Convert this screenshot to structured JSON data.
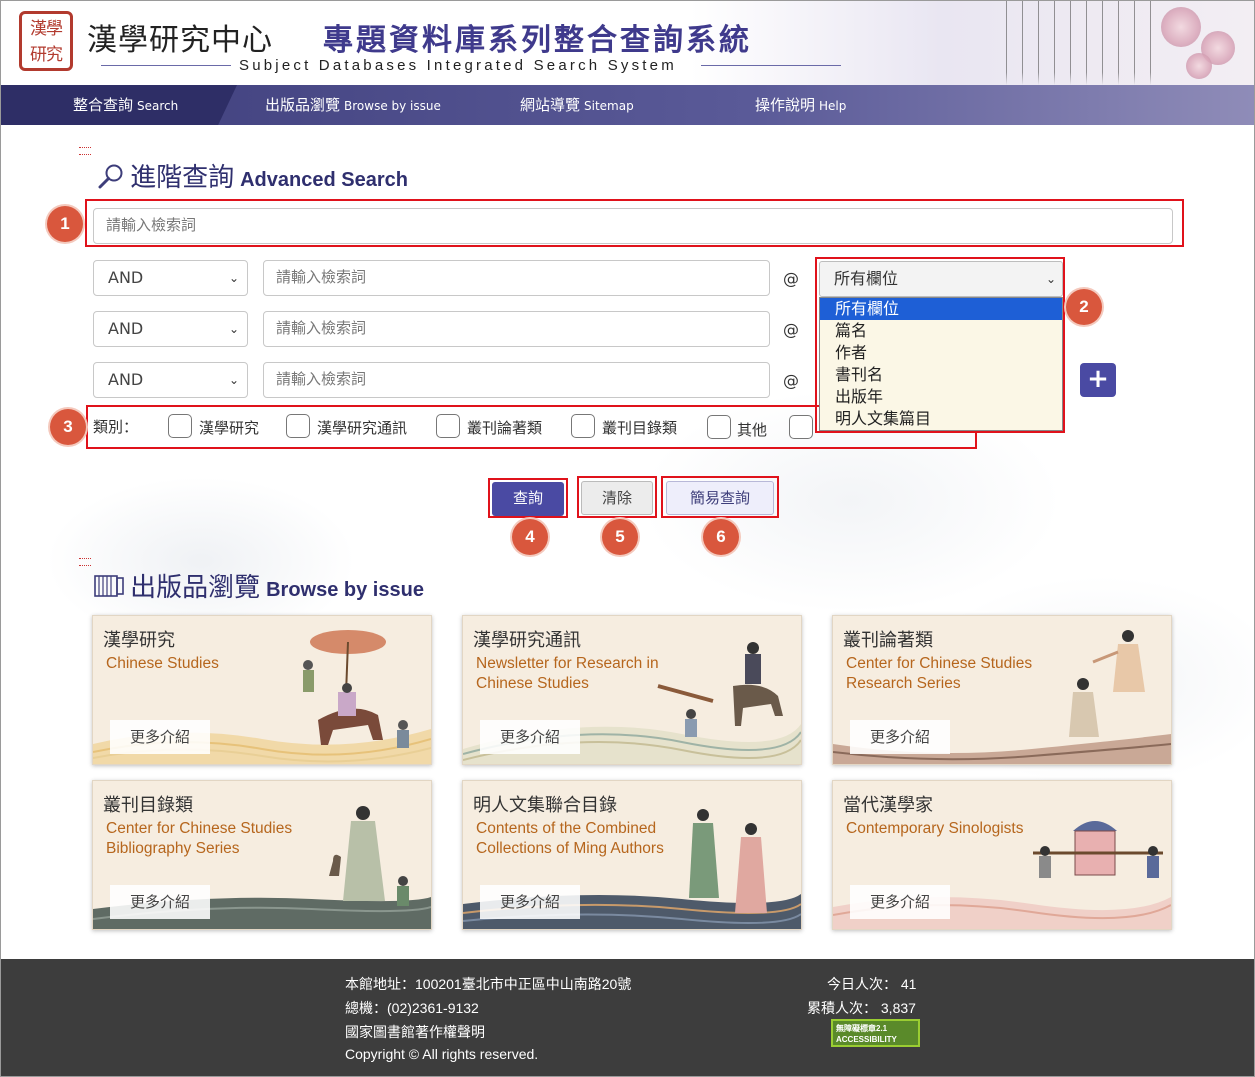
{
  "header": {
    "seal_text": "漢學研究",
    "title_cn": "漢學研究中心",
    "title_system": "專題資料庫系列整合查詢系統",
    "title_en": "Subject Databases Integrated Search System"
  },
  "nav": {
    "items": [
      {
        "cn": "整合查詢",
        "en": "Search"
      },
      {
        "cn": "出版品瀏覽",
        "en": "Browse by issue"
      },
      {
        "cn": "網站導覽",
        "en": "Sitemap"
      },
      {
        "cn": "操作說明",
        "en": "Help"
      }
    ]
  },
  "advanced": {
    "title_cn": "進階查詢",
    "title_en": "Advanced Search",
    "placeholder": "請輸入檢索詞",
    "operator": "AND",
    "at": "@",
    "field_selected": "所有欄位",
    "field_options": [
      "所有欄位",
      "篇名",
      "作者",
      "書刊名",
      "出版年",
      "明人文集篇目"
    ],
    "category_label": "類別：",
    "categories": [
      "漢學研究",
      "漢學研究通訊",
      "叢刊論著類",
      "叢刊目錄類",
      "其他"
    ]
  },
  "buttons": {
    "search": "查詢",
    "clear": "清除",
    "simple": "簡易查詢"
  },
  "badges": [
    "1",
    "2",
    "3",
    "4",
    "5",
    "6"
  ],
  "browse": {
    "title_cn": "出版品瀏覽",
    "title_en": "Browse by issue",
    "more": "更多介紹",
    "cards": [
      {
        "title": "漢學研究",
        "subtitle": "Chinese Studies"
      },
      {
        "title": "漢學研究通訊",
        "subtitle": "Newsletter for Research in Chinese Studies"
      },
      {
        "title": "叢刊論著類",
        "subtitle": "Center for Chinese Studies Research Series"
      },
      {
        "title": "叢刊目錄類",
        "subtitle": "Center for Chinese Studies Bibliography Series"
      },
      {
        "title": "明人文集聯合目錄",
        "subtitle": "Contents of the Combined Collections of Ming Authors"
      },
      {
        "title": "當代漢學家",
        "subtitle": "Contemporary Sinologists"
      }
    ]
  },
  "footer": {
    "address": "本館地址：100201臺北市中正區中山南路20號",
    "phone": "總機：(02)2361-9132",
    "copyright_notice": "國家圖書館著作權聲明",
    "copyright": "Copyright © All rights reserved.",
    "today_label": "今日人次：",
    "today_value": "41",
    "total_label": "累積人次：",
    "total_value": "3,837",
    "accessibility": "無障礙標章2.1 ACCESSIBILITY"
  },
  "colors": {
    "nav": "#3d3d7a",
    "accent": "#4a4aa3",
    "badge": "#d9573d",
    "highlight_box": "#e0121b",
    "card_subtitle": "#b6661d",
    "footer": "#3d3d3d"
  }
}
